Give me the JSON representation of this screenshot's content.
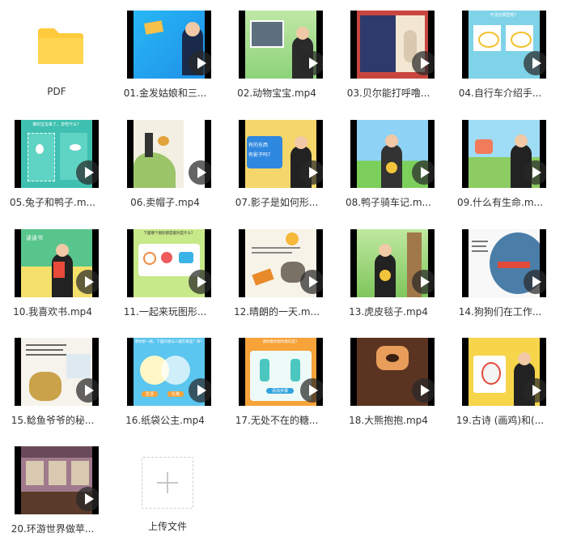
{
  "files": [
    {
      "label": "PDF"
    },
    {
      "label": "01.金发姑娘和三..."
    },
    {
      "label": "02.动物宝宝.mp4"
    },
    {
      "label": "03.贝尔能打呼噜..."
    },
    {
      "label": "04.自行车介绍手..."
    },
    {
      "label": "05.兔子和鸭子.m..."
    },
    {
      "label": "06.卖帽子.mp4"
    },
    {
      "label": "07.影子是如何形..."
    },
    {
      "label": "08.鸭子骑车记.m..."
    },
    {
      "label": "09.什么有生命.m..."
    },
    {
      "label": "10.我喜欢书.mp4"
    },
    {
      "label": "11.一起来玩图形..."
    },
    {
      "label": "12.晴朗的一天.m..."
    },
    {
      "label": "13.虎皮毯子.mp4"
    },
    {
      "label": "14.狗狗们在工作..."
    },
    {
      "label": "15.鲶鱼爷爷的秘..."
    },
    {
      "label": "16.纸袋公主.mp4"
    },
    {
      "label": "17.无处不在的糖..."
    },
    {
      "label": "18.大熊抱抱.mp4"
    },
    {
      "label": "19.古诗 (画鸡)和(..."
    },
    {
      "label": "20.环游世界做苹..."
    }
  ],
  "upload": {
    "label": "上传文件",
    "icon": "plus-icon"
  },
  "thumb_text": {
    "t04_header": "不活在哪里呢？",
    "t05_header": "谁的宝宝来了，去吃什么？",
    "t07_line1": "有的东西",
    "t07_line2": "有影子吗？",
    "t10_banner": "读读书",
    "t11_header": "下面哪个图形都是都对是什么？",
    "t16_header": "请你想一想，下面的想法人都在哪里？请？",
    "t16_btn1": "生活",
    "t16_btn2": "礼物",
    "t17_header": "请你看你想你看的是？",
    "t17_btn": "添加步骤"
  },
  "colors": {
    "folder": "#FFCB3D",
    "play_overlay": "#282828",
    "label_text": "#333333"
  }
}
